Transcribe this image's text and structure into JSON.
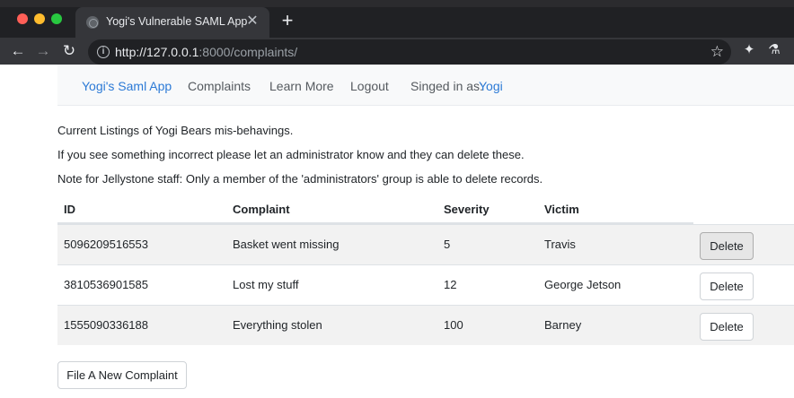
{
  "browser": {
    "tab_title": "Yogi's Vulnerable SAML App",
    "tab_close": "✕",
    "new_tab": "+",
    "url_host": "http://127.0.0.1",
    "url_rest": ":8000/complaints/",
    "icons": [
      "back-arrow-icon",
      "forward-arrow-icon",
      "reload-icon",
      "info-icon",
      "star-icon",
      "puzzle-extension-icon",
      "flask-icon"
    ]
  },
  "navbar": {
    "brand": "Yogi's Saml App",
    "complaints": "Complaints",
    "learn_more": "Learn More",
    "logout": "Logout",
    "signed_in_label": "Singed in as:",
    "user": "Yogi"
  },
  "intro": {
    "line1": "Current Listings of Yogi Bears mis-behavings.",
    "line2": "If you see something incorrect please let an administrator know and they can delete these.",
    "line3": "Note for Jellystone staff: Only a member of the 'administrators' group is able to delete records."
  },
  "table": {
    "headers": [
      "ID",
      "Complaint",
      "Severity",
      "Victim"
    ],
    "rows": [
      {
        "id": "5096209516553",
        "complaint": "Basket went missing",
        "severity": "5",
        "victim": "Travis",
        "action": "Delete"
      },
      {
        "id": "3810536901585",
        "complaint": "Lost my stuff",
        "severity": "12",
        "victim": "George Jetson",
        "action": "Delete"
      },
      {
        "id": "1555090336188",
        "complaint": "Everything stolen",
        "severity": "100",
        "victim": "Barney",
        "action": "Delete"
      }
    ]
  },
  "file_button": "File A New Complaint",
  "colors": {
    "link": "#2c7ad6",
    "chrome_bg": "#202124",
    "toolbar_bg": "#35363a"
  }
}
